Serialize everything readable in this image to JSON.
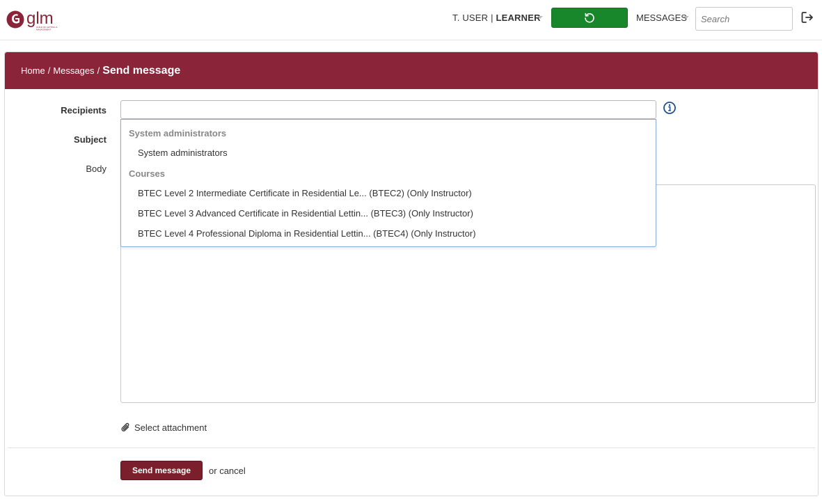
{
  "brand": {
    "logo_text": "glm",
    "logo_tagline": "GUILD OF LETTING & MANAGEMENT",
    "color": "#8a2439"
  },
  "topbar": {
    "user_name": "T. USER",
    "user_separator": "|",
    "user_role": "LEARNER",
    "refresh_icon": "refresh-icon",
    "refresh_color": "#18862a",
    "messages_label": "MESSAGES",
    "search_placeholder": "Search",
    "logout_icon": "logout-icon"
  },
  "breadcrumb": {
    "home": "Home",
    "messages": "Messages",
    "current": "Send message",
    "separator": "/"
  },
  "form": {
    "recipients_label": "Recipients",
    "subject_label": "Subject",
    "body_label": "Body",
    "recipients_value": "",
    "info_icon": "info-icon",
    "attachment_label": "Select attachment",
    "attachment_icon": "paperclip-icon",
    "send_label": "Send message",
    "or_text": "or",
    "cancel_label": "cancel"
  },
  "dropdown": {
    "groups": [
      {
        "label": "System administrators",
        "items": [
          "System administrators"
        ]
      },
      {
        "label": "Courses",
        "items": [
          "BTEC Level 2 Intermediate Certificate in Residential Le... (BTEC2) (Only Instructor)",
          "BTEC Level 3 Advanced Certificate in Residential Lettin... (BTEC3) (Only Instructor)",
          "BTEC Level 4 Professional Diploma in Residential Lettin... (BTEC4) (Only Instructor)"
        ]
      }
    ]
  }
}
